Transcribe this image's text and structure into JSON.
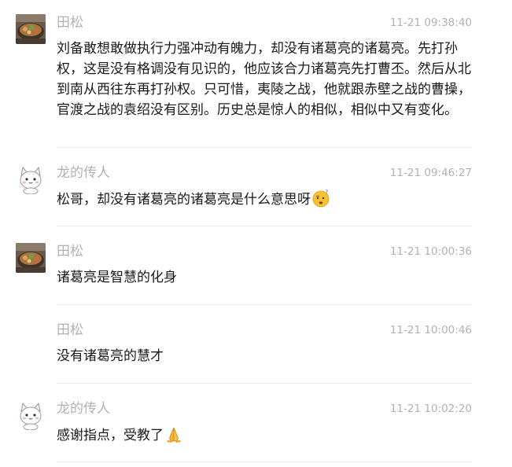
{
  "messages": [
    {
      "sender": "田松",
      "time": "11-21 09:38:40",
      "text": "刘备敢想敢做执行力强冲动有魄力，却没有诸葛亮的诸葛亮。先打孙权，这是没有格调没有见识的，他应该合力诸葛亮先打曹丕。然后从北到南从西往东再打孙权。只可惜，夷陵之战，他就跟赤壁之战的曹操，官渡之战的袁绍没有区别。历史总是惊人的相似，相似中又有变化。",
      "avatar_icon": "food-pot-avatar"
    },
    {
      "sender": "龙的传人",
      "time": "11-21 09:46:27",
      "text": "松哥，却没有诸葛亮的诸葛亮是什么意思呀",
      "avatar_icon": "cartoon-cat-avatar",
      "emoji": "thinking-face-emoji"
    },
    {
      "sender": "田松",
      "time": "11-21 10:00:36",
      "text": "诸葛亮是智慧的化身",
      "avatar_icon": "food-pot-avatar"
    },
    {
      "sender": "田松",
      "time": "11-21 10:00:46",
      "text": "没有诸葛亮的慧才"
    },
    {
      "sender": "龙的传人",
      "time": "11-21 10:02:20",
      "text": "感谢指点，受教了",
      "avatar_icon": "cartoon-cat-avatar",
      "emoji": "praying-hands-emoji"
    }
  ],
  "colors": {
    "name": "#b2b2b2",
    "time": "#b2b2b2",
    "text": "#191919",
    "divider": "#ececec"
  }
}
